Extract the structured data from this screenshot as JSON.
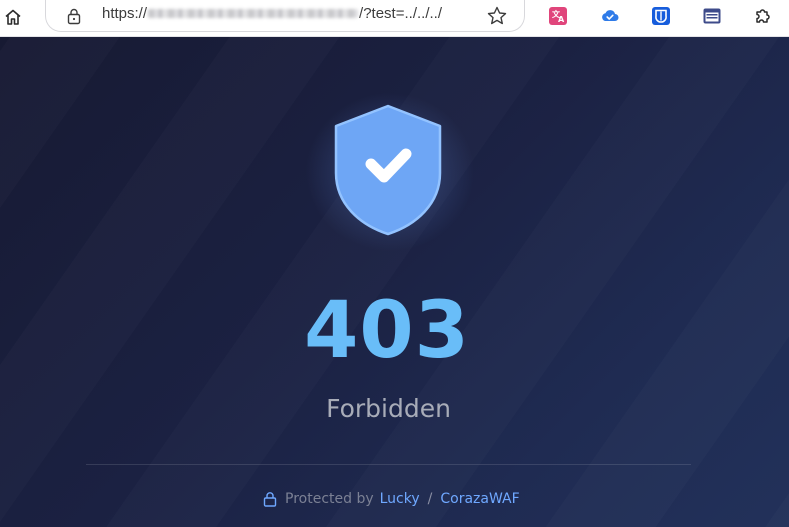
{
  "browser": {
    "url_prefix": "https://",
    "url_suffix": "/?test=../../../",
    "extensions": [
      "translate-extension-icon",
      "cloud-extension-icon",
      "bitwarden-extension-icon",
      "window-extension-icon",
      "extensions-puzzle-icon"
    ]
  },
  "colors": {
    "code": "#69bdf8",
    "shield_fill": "#6ea6f5",
    "link": "#6fa8ff",
    "background": "#1b2142"
  },
  "main": {
    "code": "403",
    "status": "Forbidden"
  },
  "footer": {
    "protected_by": "Protected by",
    "link1": "Lucky",
    "separator": "/",
    "link2": "CorazaWAF"
  }
}
